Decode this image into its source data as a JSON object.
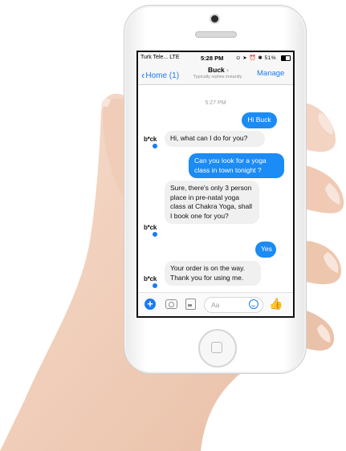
{
  "status_bar": {
    "carrier": "Turk Tele...",
    "network": "LTE",
    "time": "5:28 PM",
    "battery": "51%"
  },
  "navbar": {
    "back_label": "Home (1)",
    "contact_name": "Buck",
    "contact_status": "Typically replies instantly",
    "manage_label": "Manage"
  },
  "conversation": {
    "timestamp": "5:27 PM",
    "bot_avatar_text": "b*ck",
    "messages": [
      {
        "from": "user",
        "text": "Hi Buck"
      },
      {
        "from": "bot",
        "text": "Hi, what can I do for you?"
      },
      {
        "from": "user",
        "text": "Can you look for a yoga class in town tonight ?"
      },
      {
        "from": "bot",
        "text": "Sure, there's only 3 person place in pre-natal yoga class at Chakra Yoga, shall I book one for you?"
      },
      {
        "from": "user",
        "text": "Yes"
      },
      {
        "from": "bot",
        "text": "Your order is on the way. Thank you for using me."
      }
    ]
  },
  "composer": {
    "placeholder": "Aa"
  },
  "colors": {
    "accent": "#1b7af4",
    "outgoing_bubble": "#1b8bf5",
    "incoming_bubble": "#f0f0f0"
  }
}
